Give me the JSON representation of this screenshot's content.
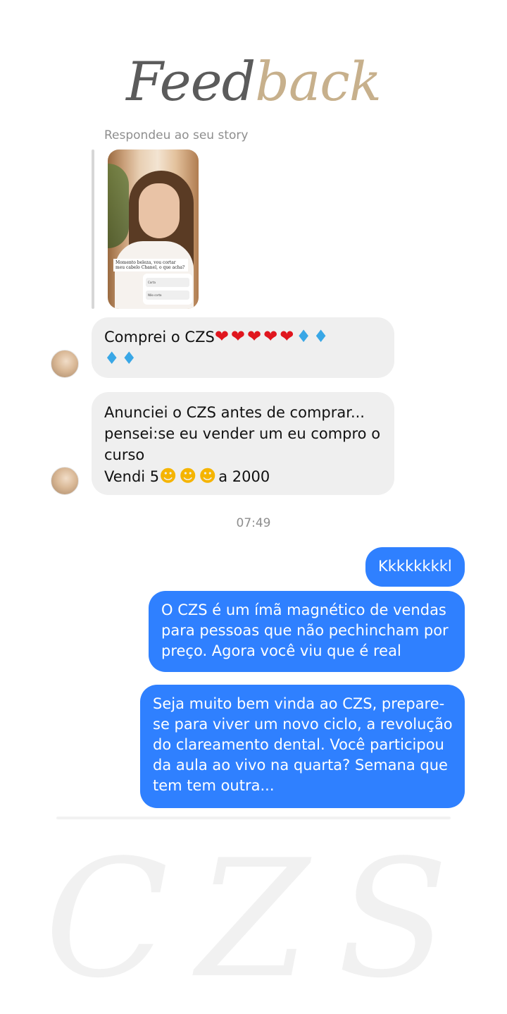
{
  "header": {
    "title_part1": "Feed",
    "title_part2": "back",
    "title_colors": {
      "part1": "#5b5b5b",
      "part2": "#c7b08c"
    }
  },
  "story_reply": {
    "label": "Respondeu ao seu story",
    "caption": "Momento beleza, vou cortar meu cabelo Chanel, o que acha?",
    "poll_options": [
      "Corta",
      "Não corta"
    ]
  },
  "messages_in": [
    {
      "text": "Comprei o CZS",
      "emoji_line1": "❤❤❤❤❤",
      "emoji_line1b": "♦♦",
      "emoji_line2": "♦♦"
    },
    {
      "line1": "Anunciei o CZS antes de comprar...",
      "line2": "pensei:se eu vender um eu compro o",
      "line3": "curso",
      "line4_prefix": "Vendi 5",
      "line4_emoji": "☻☻☻",
      "line4_suffix": "a 2000"
    }
  ],
  "timestamp": "07:49",
  "messages_out": [
    {
      "text": "Kkkkkkkkl"
    },
    {
      "line1": "O CZS é um ímã magnético de vendas",
      "line2": "para pessoas que não pechincham por",
      "line3": "preço. Agora você viu que é real"
    },
    {
      "line1": "Seja muito bem vinda ao CZS, prepare-",
      "line2": "se para viver um novo ciclo, a revolução",
      "line3": "do clareamento dental. Você participou",
      "line4": "da aula ao vivo na quarta? Semana que",
      "line5": "tem tem outra..."
    }
  ],
  "watermark": "CZS",
  "colors": {
    "outgoing_bubble": "#2f80ff",
    "incoming_bubble": "#efefef",
    "background": "#ffffff"
  }
}
